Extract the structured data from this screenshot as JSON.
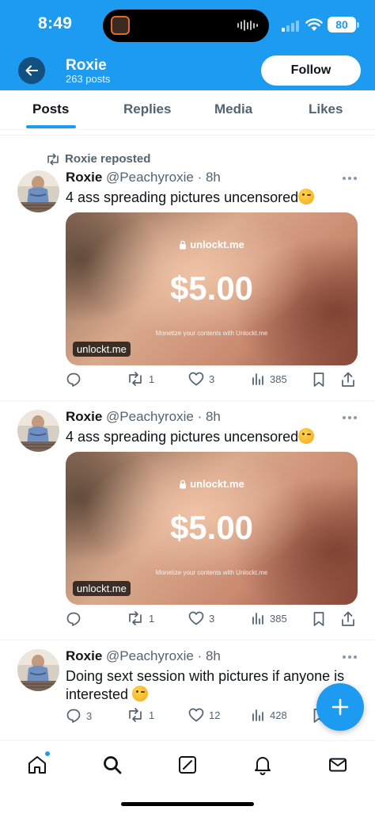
{
  "status_bar": {
    "time": "8:49",
    "battery": "80"
  },
  "header": {
    "name": "Roxie",
    "post_count": "263 posts",
    "follow_label": "Follow"
  },
  "tabs": [
    {
      "label": "Posts",
      "active": true
    },
    {
      "label": "Replies",
      "active": false
    },
    {
      "label": "Media",
      "active": false
    },
    {
      "label": "Likes",
      "active": false
    }
  ],
  "posts": [
    {
      "repost_label": "Roxie reposted",
      "author": "Roxie",
      "handle": "@Peachyroxie",
      "time": "· 8h",
      "text": "4 ass spreading pictures uncensored",
      "emoji": "winking-face",
      "card": {
        "brand": "unlockt.me",
        "price": "$5.00",
        "subtitle": "Monetize your contents with Unlockt.me",
        "domain": "unlockt.me"
      },
      "replies": "",
      "reposts": "1",
      "likes": "3",
      "views": "385"
    },
    {
      "author": "Roxie",
      "handle": "@Peachyroxie",
      "time": "· 8h",
      "text": "4 ass spreading pictures uncensored",
      "emoji": "winking-face",
      "card": {
        "brand": "unlockt.me",
        "price": "$5.00",
        "subtitle": "Monetize your contents with Unlockt.me",
        "domain": "unlockt.me"
      },
      "replies": "",
      "reposts": "1",
      "likes": "3",
      "views": "385"
    },
    {
      "author": "Roxie",
      "handle": "@Peachyroxie",
      "time": "· 8h",
      "text": "Doing sext session with pictures if anyone is interested",
      "emoji": "winking-face",
      "replies": "3",
      "reposts": "1",
      "likes": "12",
      "views": "428"
    }
  ],
  "nav": {
    "items": [
      "home-icon",
      "search-icon",
      "grok-icon",
      "notifications-icon",
      "messages-icon"
    ],
    "accent": "#1d9bf0"
  },
  "colors": {
    "brand": "#1d9bf0",
    "text": "#0f1419",
    "muted": "#536471"
  }
}
